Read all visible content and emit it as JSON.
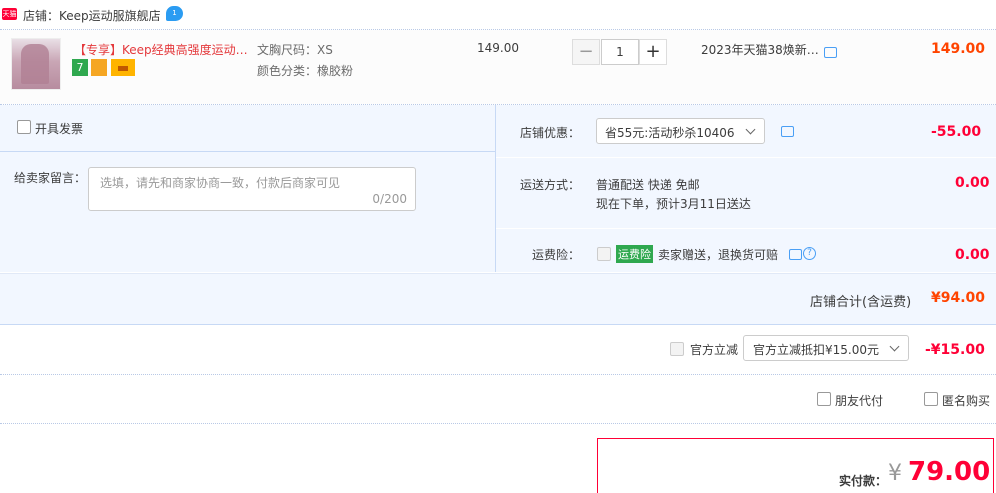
{
  "shop": {
    "badge": "天猫",
    "name": "店铺：Keep运动服旗舰店",
    "chat_badge": "1"
  },
  "item": {
    "title": "【专享】Keep经典高强度运动…",
    "tags": [
      "7",
      "",
      ""
    ],
    "attr_size": "文胸尺码：XS",
    "attr_color": "颜色分类：橡胶粉",
    "unit_price": "149.00",
    "qty": "1",
    "minus": "−",
    "plus": "+",
    "promo": "2023年天猫38焕新…",
    "subtotal": "149.00"
  },
  "invoice": {
    "label": "开具发票"
  },
  "message": {
    "label": "给卖家留言：",
    "placeholder": "选填，请先和商家协商一致，付款后商家可见",
    "counter": "0/200"
  },
  "discount": {
    "label": "店铺优惠：",
    "selected": "省55元:活动秒杀10406",
    "value": "-55.00"
  },
  "shipping": {
    "label": "运送方式：",
    "method": "普通配送 快递 免邮",
    "eta": "现在下单，预计3月11日送达",
    "value": "0.00"
  },
  "insurance": {
    "label": "运费险：",
    "tag": "运费险",
    "desc": "卖家赠送，退换货可赔",
    "value": "0.00"
  },
  "shop_total": {
    "label": "店铺合计(含运费)",
    "value": "¥94.00"
  },
  "official": {
    "label": "官方立减",
    "selected": "官方立减抵扣¥15.00元",
    "value": "-¥15.00"
  },
  "options": {
    "friend_pay": "朋友代付",
    "anonymous": "匿名购买"
  },
  "payment": {
    "label": "实付款：",
    "currency": "¥",
    "value": "79.00"
  },
  "colors": {
    "accent": "#ff0036",
    "price": "#ff4400",
    "panel": "#f2f7ff"
  }
}
